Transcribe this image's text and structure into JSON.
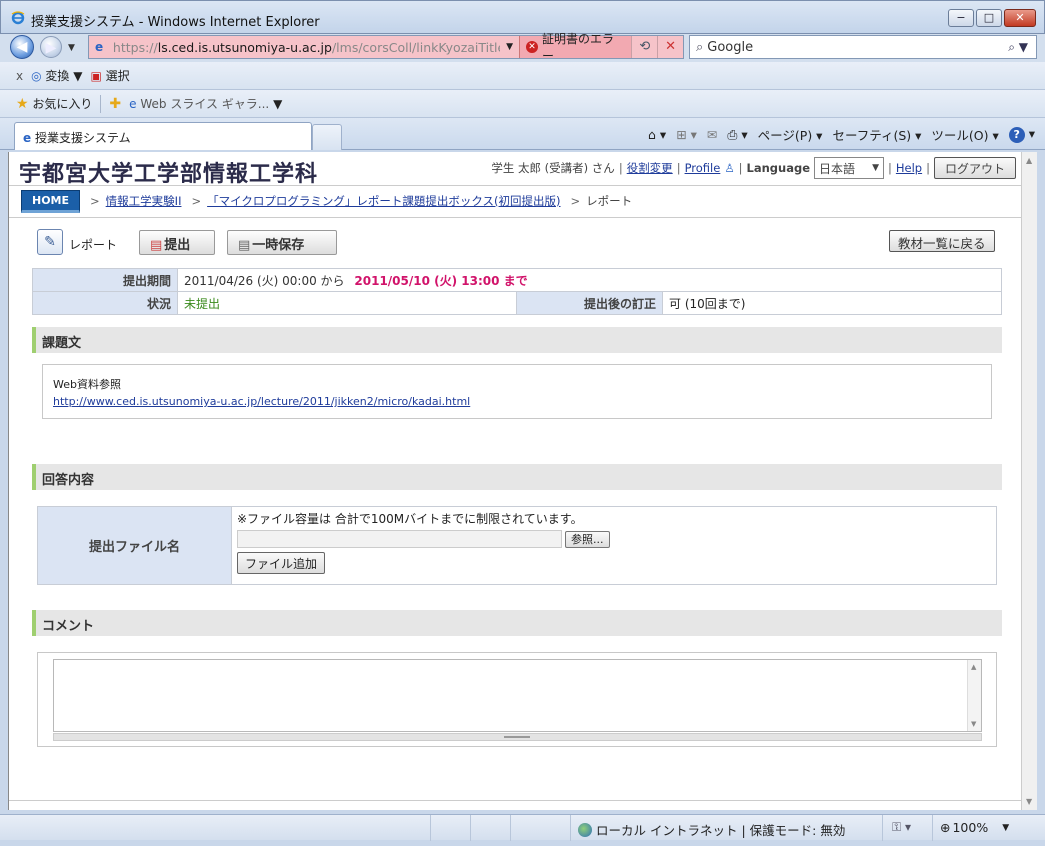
{
  "window": {
    "title": "授業支援システム - Windows Internet Explorer",
    "min": "−",
    "max": "□",
    "close": "✕"
  },
  "address": {
    "url_scheme": "https://",
    "url_host": "ls.ced.is.utsunomiya-u.ac.jp",
    "url_path": "/lms/corsColl/linkKyozaiTitle",
    "cert_error": "証明書のエラー",
    "search_engine": "Google"
  },
  "toolbar2": {
    "close": "x",
    "convert": "変換",
    "select": "選択"
  },
  "favorites_bar": {
    "favorites": "お気に入り",
    "web_slice": "Web スライス ギャラ..."
  },
  "tab": {
    "label": "授業支援システム"
  },
  "commands": {
    "page": "ページ(P)",
    "safety": "セーフティ(S)",
    "tools": "ツール(O)",
    "help": "?"
  },
  "site": {
    "title": "宇都宮大学工学部情報工学科",
    "user": "学生 太郎 (受講者) さん",
    "role_change": "役割変更",
    "profile": "Profile",
    "language_label": "Language",
    "language_value": "日本語",
    "help": "Help",
    "logout": "ログアウト"
  },
  "breadcrumb": {
    "home": "HOME",
    "item1": "情報工学実験II",
    "item2": "「マイクロプログラミング」レポート課題提出ボックス(初回提出版)",
    "current": "レポート",
    "sep": ">"
  },
  "actions": {
    "report_label": "レポート",
    "submit": "提出",
    "temp_save": "一時保存",
    "back_to_list": "教材一覧に戻る"
  },
  "info": {
    "period_label": "提出期間",
    "period_start": "2011/04/26 (火) 00:00 から",
    "period_end": "2011/05/10 (火) 13:00 まで",
    "status_label": "状況",
    "status_value": "未提出",
    "revision_label": "提出後の訂正",
    "revision_value": "可 (10回まで)"
  },
  "task": {
    "heading": "課題文",
    "text": "Web資料参照",
    "link": "http://www.ced.is.utsunomiya-u.ac.jp/lecture/2011/jikken2/micro/kadai.html"
  },
  "answer": {
    "heading": "回答内容",
    "file_label": "提出ファイル名",
    "notice": "※ファイル容量は 合計で100Mバイトまでに制限されています。",
    "browse": "参照...",
    "add_file": "ファイル追加"
  },
  "comment": {
    "heading": "コメント"
  },
  "status": {
    "zone": "ローカル イントラネット | 保護モード: 無効",
    "zoom": "100%"
  },
  "colors": {
    "deadline": "#d1136a",
    "status_ok": "#3a8a1c",
    "home_btn": "#1b5fa8",
    "section_accent": "#9fcf70",
    "label_bg": "#dbe4f3"
  }
}
